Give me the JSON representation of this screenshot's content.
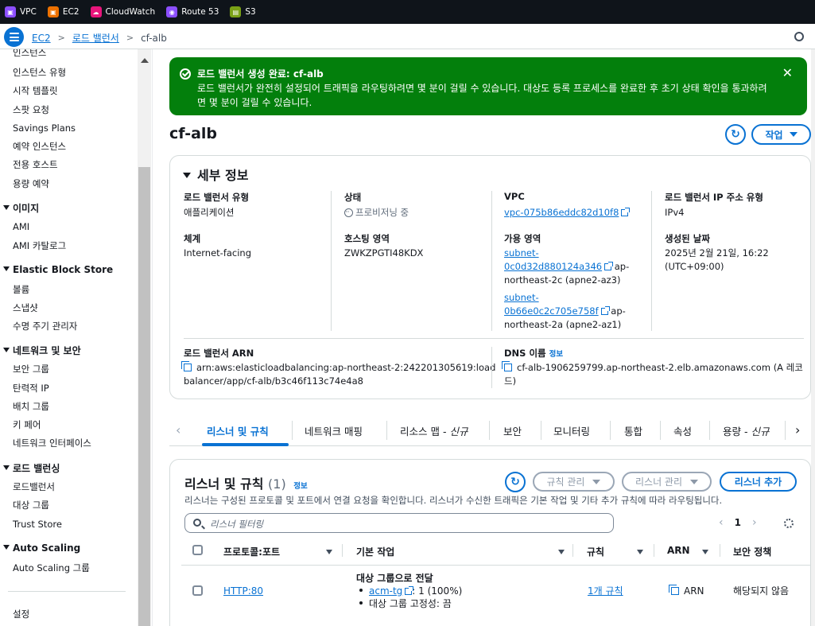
{
  "service_bar": [
    {
      "label": "VPC",
      "color": "#8c4fff",
      "icon": "vpc-icon"
    },
    {
      "label": "EC2",
      "color": "#ed7100",
      "icon": "ec2-icon"
    },
    {
      "label": "CloudWatch",
      "color": "#e7157b",
      "icon": "cloudwatch-icon"
    },
    {
      "label": "Route 53",
      "color": "#8c4fff",
      "icon": "route53-icon"
    },
    {
      "label": "S3",
      "color": "#7aa116",
      "icon": "s3-icon"
    }
  ],
  "breadcrumb": {
    "ec2": "EC2",
    "lb": "로드 밸런서",
    "current": "cf-alb"
  },
  "sidebar": {
    "items_top": [
      "인스턴스",
      "인스턴스 유형",
      "시작 템플릿",
      "스팟 요청",
      "Savings Plans",
      "예약 인스턴스",
      "전용 호스트",
      "용량 예약"
    ],
    "images_head": "이미지",
    "images": [
      "AMI",
      "AMI 카탈로그"
    ],
    "ebs_head": "Elastic Block Store",
    "ebs": [
      "볼륨",
      "스냅샷",
      "수명 주기 관리자"
    ],
    "net_head": "네트워크 및 보안",
    "net": [
      "보안 그룹",
      "탄력적 IP",
      "배치 그룹",
      "키 페어",
      "네트워크 인터페이스"
    ],
    "lb_head": "로드 밸런싱",
    "lb": [
      "로드밸런서",
      "대상 그룹",
      "Trust Store"
    ],
    "as_head": "Auto Scaling",
    "as": [
      "Auto Scaling 그룹"
    ],
    "settings": "설정"
  },
  "flash": {
    "title": "로드 밸런서 생성 완료: cf-alb",
    "message": "로드 밸런서가 완전히 설정되어 트래픽을 라우팅하려면 몇 분이 걸릴 수 있습니다. 대상도 등록 프로세스를 완료한 후 초기 상태 확인을 통과하려면 몇 분이 걸릴 수 있습니다.",
    "close": "✕"
  },
  "page": {
    "title": "cf-alb",
    "refresh": "↻",
    "action": "작업"
  },
  "details": {
    "title": "세부 정보",
    "lb_type_label": "로드 밸런서 유형",
    "lb_type": "애플리케이션",
    "state_label": "상태",
    "state": "프로비저닝 중",
    "vpc_label": "VPC",
    "vpc": "vpc-075b86eddc82d10f8",
    "ip_type_label": "로드 밸런서 IP 주소 유형",
    "ip_type": "IPv4",
    "scheme_label": "체계",
    "scheme": "Internet-facing",
    "hosted_zone_label": "호스팅 영역",
    "hosted_zone": "ZWKZPGTI48KDX",
    "az_label": "가용 영역",
    "az1_line1": "subnet-",
    "az1_line2": "0c0d32d880124a346",
    "az1_suffix": "ap-",
    "az1_zone": "northeast-2c (apne2-az3)",
    "az2_line1": "subnet-",
    "az2_line2": "0b66e0c2c705e758f",
    "az2_suffix": "ap-",
    "az2_zone": "northeast-2a (apne2-az1)",
    "created_label": "생성된 날짜",
    "created_line1": "2025년 2월 21일, 16:22",
    "created_line2": "(UTC+09:00)",
    "arn_label": "로드 밸런서 ARN",
    "arn_line1": "arn:aws:elasticloadbalancing:ap-northeast-2:242201305619:load",
    "arn_line2": "balancer/app/cf-alb/b3c46f113c74e4a8",
    "dns_label": "DNS 이름",
    "dns_info": "정보",
    "dns_line1": "cf-alb-1906259799.ap-northeast-2.elb.amazonaws.com (A 레코",
    "dns_line2": "드)"
  },
  "tabs": [
    {
      "label": "리스너 및 규칙"
    },
    {
      "label": "네트워크 매핑"
    },
    {
      "label": "리소스 맵 - ",
      "tag": "신규"
    },
    {
      "label": "보안"
    },
    {
      "label": "모니터링"
    },
    {
      "label": "통합"
    },
    {
      "label": "속성"
    },
    {
      "label": "용량 - ",
      "tag": "신규"
    }
  ],
  "listeners": {
    "title": "리스너 및 규칙",
    "count": "(1)",
    "info": "정보",
    "description": "리스너는 구성된 프로토콜 및 포트에서 연결 요청을 확인합니다. 리스너가 수신한 트래픽은 기본 작업 및 기타 추가 규칙에 따라 라우팅됩니다.",
    "manage_rules": "규칙 관리",
    "manage_listener": "리스너 관리",
    "add_listener": "리스너 추가",
    "filter_placeholder": "리스너 필터링",
    "page": "1",
    "columns": [
      "프로토콜:포트",
      "기본 작업",
      "규칙",
      "ARN",
      "보안 정책"
    ],
    "row": {
      "protocol": "HTTP:80",
      "action_title": "대상 그룹으로 전달",
      "tg_link": "acm-tg",
      "tg_weight": ": 1 (100%)",
      "stickiness": "대상 그룹 고정성: 끔",
      "rules": "1개 규칙",
      "arn": "ARN",
      "policy": "해당되지 않음"
    }
  }
}
